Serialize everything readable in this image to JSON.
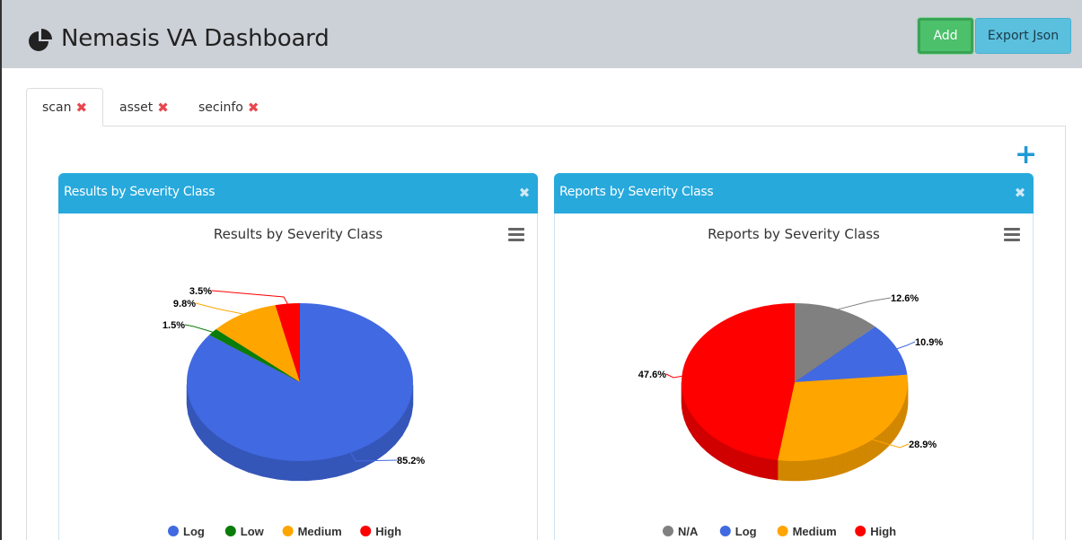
{
  "app": {
    "title": "Nemasis VA Dashboard"
  },
  "header": {
    "add_label": "Add",
    "export_label": "Export Json"
  },
  "tabs": [
    {
      "label": "scan",
      "close": "✖"
    },
    {
      "label": "asset",
      "close": "✖"
    },
    {
      "label": "secinfo",
      "close": "✖"
    }
  ],
  "add_widget": "+",
  "panels": [
    {
      "header": "Results by Severity Class",
      "close": "✖"
    },
    {
      "header": "Reports by Severity Class",
      "close": "✖"
    }
  ],
  "colors": {
    "accent": "#27a9dc",
    "add": "#4cc06a",
    "export": "#5bc0de",
    "tab_close": "#e8474c"
  },
  "chart_data": [
    {
      "type": "pie",
      "title": "Results by Severity Class",
      "categories": [
        "Log",
        "Low",
        "Medium",
        "High"
      ],
      "values": [
        85.2,
        1.5,
        9.8,
        3.5
      ],
      "labels": [
        "85.2%",
        "1.5%",
        "9.8%",
        "3.5%"
      ],
      "colors": [
        "#4169e1",
        "#0a7c0a",
        "#ffa500",
        "#ff0000"
      ],
      "legend": "bottom"
    },
    {
      "type": "pie",
      "title": "Reports by Severity Class",
      "categories": [
        "N/A",
        "Log",
        "Medium",
        "High"
      ],
      "values": [
        12.6,
        10.9,
        28.9,
        47.6
      ],
      "labels": [
        "12.6%",
        "10.9%",
        "28.9%",
        "47.6%"
      ],
      "colors": [
        "#808080",
        "#4169e1",
        "#ffa500",
        "#ff0000"
      ],
      "legend": "bottom"
    }
  ]
}
